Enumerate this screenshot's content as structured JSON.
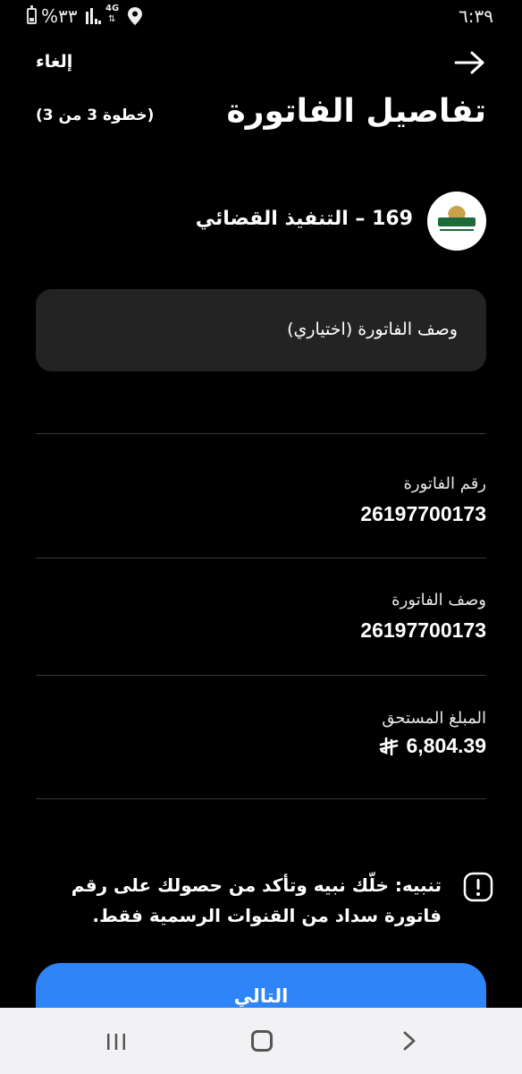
{
  "status": {
    "battery_text": "%٣٣",
    "network": "4G",
    "time": "٦:٣٩"
  },
  "nav": {
    "cancel_label": "إلغاء"
  },
  "header": {
    "title": "تفاصيل الفاتورة",
    "step": "(خطوة 3 من 3)"
  },
  "biller": {
    "name": "169 – التنفيذ القضائي",
    "logo_icon": "ministry-of-justice-logo"
  },
  "description_input": {
    "placeholder": "وصف الفاتورة (اختياري)"
  },
  "fields": {
    "invoice_number_label": "رقم الفاتورة",
    "invoice_number_value": "26197700173",
    "invoice_desc_label": "وصف الفاتورة",
    "invoice_desc_value": "26197700173",
    "amount_label": "المبلغ المستحق",
    "amount_value": "6,804.39",
    "currency_icon": "saudi-riyal-icon"
  },
  "warning": {
    "text": "تنبيه: خلّك نبيه وتأكد من حصولك على رقم فاتورة سداد من القنوات الرسمية فقط."
  },
  "button": {
    "next_label": "التالي"
  },
  "colors": {
    "background": "#000000",
    "input_bg": "#232323",
    "primary": "#2f85f7",
    "divider": "#3a3a3a",
    "navbar_bg": "#f2f2f4"
  }
}
